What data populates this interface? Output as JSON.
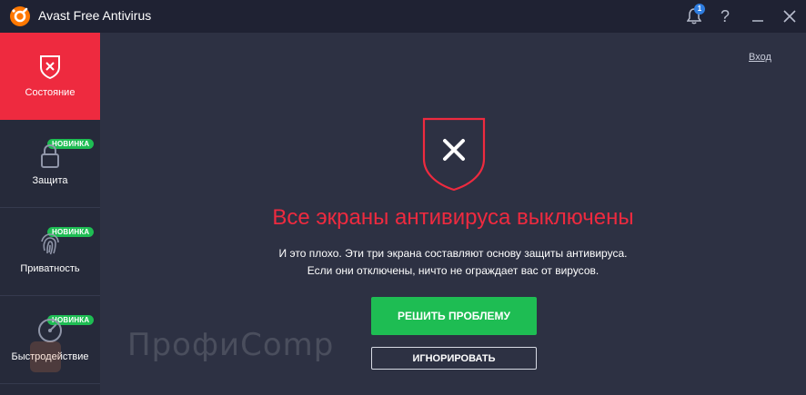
{
  "window": {
    "title": "Avast Free Antivirus",
    "notifications_count": "1",
    "help_label": "?"
  },
  "sidebar": {
    "items": [
      {
        "label": "Состояние",
        "icon": "shield-x-icon",
        "badge": ""
      },
      {
        "label": "Защита",
        "icon": "lock-icon",
        "badge": "НОВИНКА"
      },
      {
        "label": "Приватность",
        "icon": "fingerprint-icon",
        "badge": "НОВИНКА"
      },
      {
        "label": "Быстродействие",
        "icon": "gauge-icon",
        "badge": "НОВИНКА"
      }
    ]
  },
  "main": {
    "logout_label": "Вход",
    "headline": "Все экраны антивируса выключены",
    "description_line1": "И это плохо. Эти три экрана составляют основу защиты антивируса.",
    "description_line2": "Если они отключены, ничто не ограждает вас от вирусов.",
    "fix_button": "РЕШИТЬ ПРОБЛЕМУ",
    "ignore_button": "ИГНОРИРОВАТЬ"
  },
  "watermark": {
    "text": "ПрофиComp"
  },
  "colors": {
    "accent_red": "#ee2a3f",
    "success_green": "#1ebd53",
    "background": "#2d3143",
    "titlebar": "#1f2233",
    "sidebar": "#262a3a"
  }
}
